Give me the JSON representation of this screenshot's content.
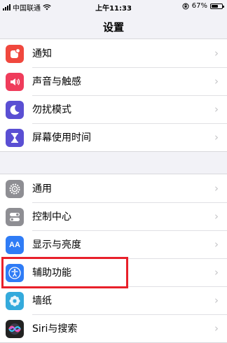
{
  "status_bar": {
    "carrier": "中国联通",
    "time": "上午11:33",
    "battery_percent": "67%",
    "battery_level": 0.67
  },
  "title": "设置",
  "groups": [
    {
      "items": [
        {
          "label": "通知",
          "icon": "notifications-icon",
          "color": "#f0483e"
        },
        {
          "label": "声音与触感",
          "icon": "sounds-icon",
          "color": "#ef3c5b"
        },
        {
          "label": "勿扰模式",
          "icon": "moon-icon",
          "color": "#5a4fd3"
        },
        {
          "label": "屏幕使用时间",
          "icon": "hourglass-icon",
          "color": "#5a4fd3"
        }
      ]
    },
    {
      "items": [
        {
          "label": "通用",
          "icon": "gear-icon",
          "color": "#8e8e93"
        },
        {
          "label": "控制中心",
          "icon": "toggles-icon",
          "color": "#8e8e93"
        },
        {
          "label": "显示与亮度",
          "icon": "text-size-icon",
          "color": "#2f7cf6"
        },
        {
          "label": "辅助功能",
          "icon": "accessibility-icon",
          "color": "#2f7cf6"
        },
        {
          "label": "墙纸",
          "icon": "wallpaper-flower-icon",
          "color": "#34aadc"
        },
        {
          "label": "Siri与搜索",
          "icon": "siri-icon",
          "color": "#222222"
        }
      ]
    }
  ],
  "icon_text": {
    "display": "AA"
  },
  "chevron": "›",
  "highlight_color": "#e8202a"
}
